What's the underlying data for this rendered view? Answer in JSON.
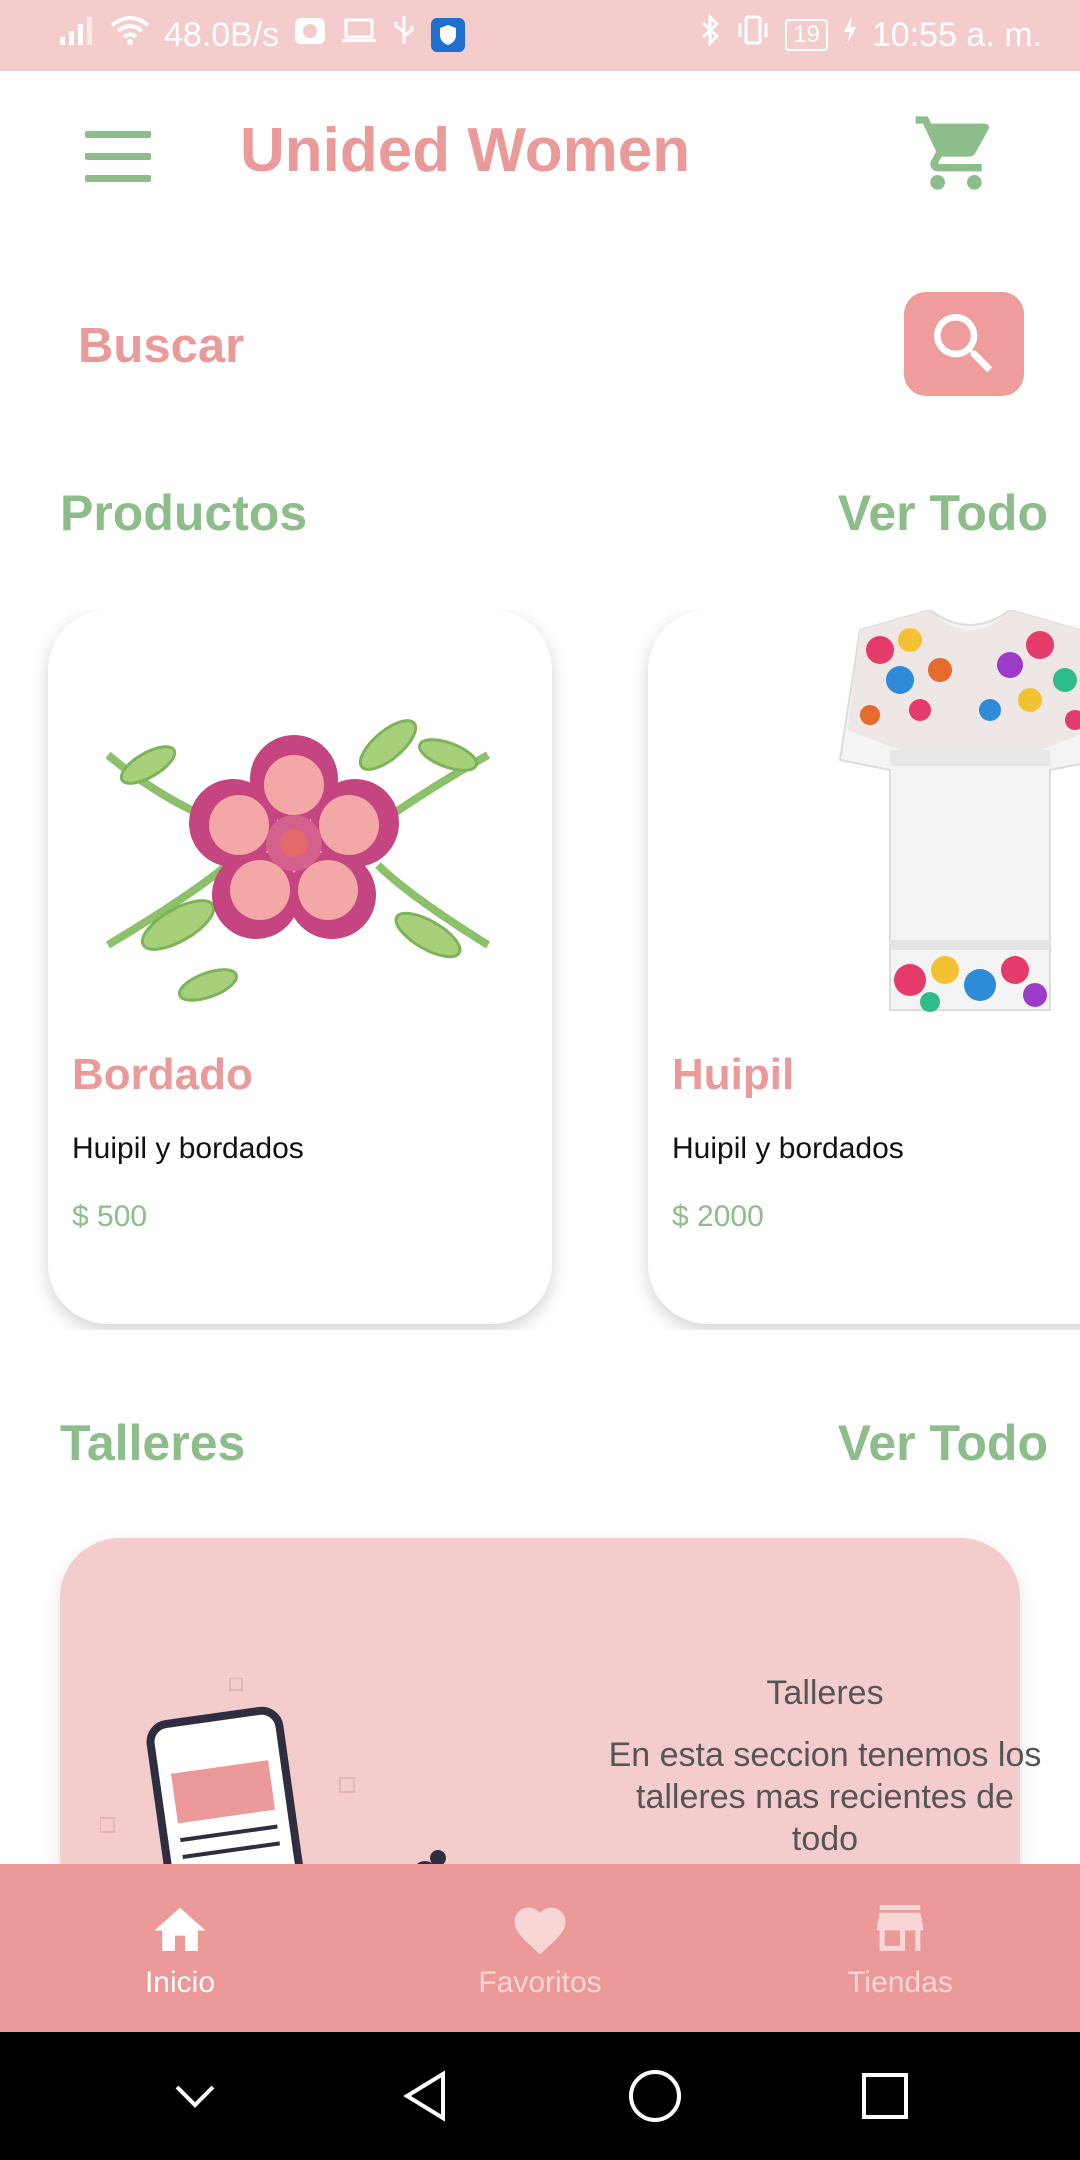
{
  "status_bar": {
    "speed": "48.0B/s",
    "battery": "19",
    "time": "10:55 a. m."
  },
  "app_bar": {
    "title": "Unided Women"
  },
  "search": {
    "label": "Buscar"
  },
  "products_section": {
    "title": "Productos",
    "see_all": "Ver Todo",
    "items": [
      {
        "name": "Bordado",
        "description": "Huipil y bordados",
        "price": "$ 500"
      },
      {
        "name": "Huipil",
        "description": "Huipil y bordados",
        "price": "$ 2000"
      }
    ]
  },
  "workshops_section": {
    "title": "Talleres",
    "see_all": "Ver Todo",
    "card": {
      "title": "Talleres",
      "text": "En esta seccion tenemos los talleres mas recientes de todo"
    }
  },
  "bottom_nav": {
    "items": [
      {
        "label": "Inicio",
        "icon": "home-icon",
        "active": true
      },
      {
        "label": "Favoritos",
        "icon": "heart-icon",
        "active": false
      },
      {
        "label": "Tiendas",
        "icon": "store-icon",
        "active": false
      }
    ]
  },
  "colors": {
    "primary_pink": "#eb9a9a",
    "green": "#8cbd8a",
    "status_bar": "#f5cccc",
    "nav_bar": "#ec9999"
  }
}
